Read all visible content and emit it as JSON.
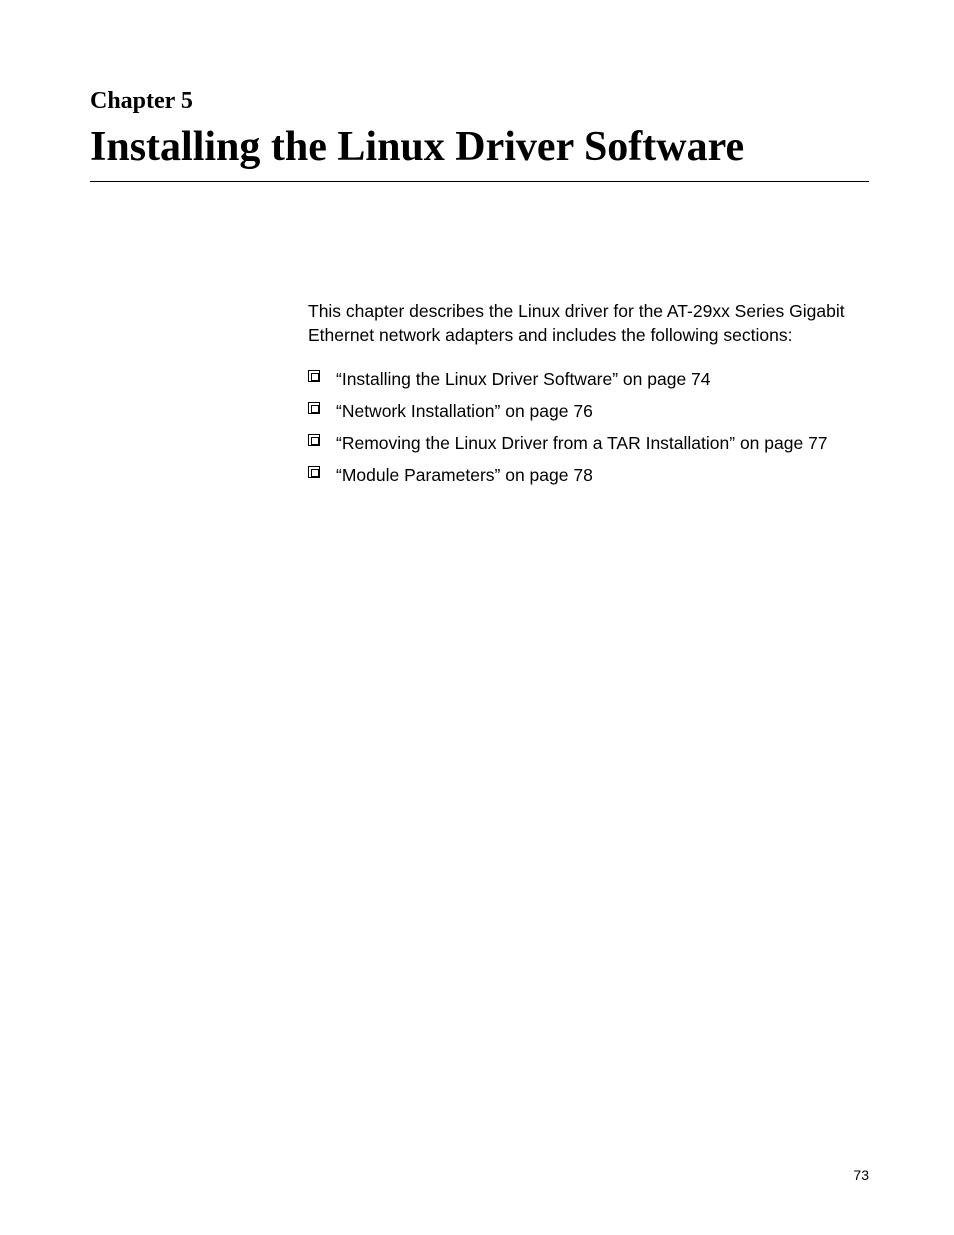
{
  "chapter": {
    "label": "Chapter 5",
    "title": "Installing the Linux Driver Software"
  },
  "intro": "This chapter describes the Linux driver for the AT-29xx Series Gigabit Ethernet network adapters and includes the following sections:",
  "sections": [
    "“Installing the Linux Driver Software” on page 74",
    "“Network Installation” on page 76",
    "“Removing the Linux Driver from a TAR Installation” on page 77",
    "“Module Parameters” on page 78"
  ],
  "page_number": "73"
}
